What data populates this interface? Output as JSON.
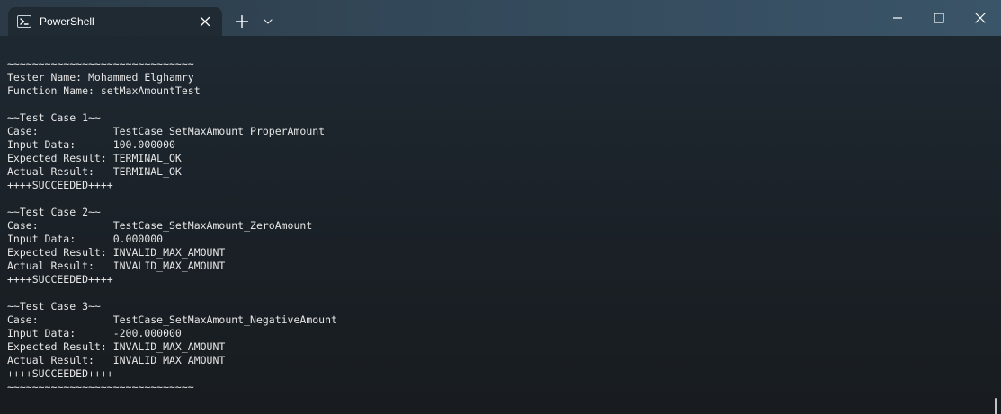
{
  "window": {
    "tab": {
      "title": "PowerShell",
      "icon": "powershell-icon"
    },
    "titlebar_icons": {
      "close_tab": "close-icon",
      "new_tab": "plus-icon",
      "dropdown": "chevron-down-icon",
      "minimize": "minimize-icon",
      "maximize": "maximize-icon",
      "close_window": "close-icon"
    }
  },
  "terminal": {
    "lines": [
      "~~~~~~~~~~~~~~~~~~~~~~~~~~~~~~",
      "Tester Name: Mohammed Elghamry",
      "Function Name: setMaxAmountTest",
      "",
      "~~Test Case 1~~",
      "Case:            TestCase_SetMaxAmount_ProperAmount",
      "Input Data:      100.000000",
      "Expected Result: TERMINAL_OK",
      "Actual Result:   TERMINAL_OK",
      "++++SUCCEEDED++++",
      "",
      "~~Test Case 2~~",
      "Case:            TestCase_SetMaxAmount_ZeroAmount",
      "Input Data:      0.000000",
      "Expected Result: INVALID_MAX_AMOUNT",
      "Actual Result:   INVALID_MAX_AMOUNT",
      "++++SUCCEEDED++++",
      "",
      "~~Test Case 3~~",
      "Case:            TestCase_SetMaxAmount_NegativeAmount",
      "Input Data:      -200.000000",
      "Expected Result: INVALID_MAX_AMOUNT",
      "Actual Result:   INVALID_MAX_AMOUNT",
      "++++SUCCEEDED++++",
      "~~~~~~~~~~~~~~~~~~~~~~~~~~~~~~"
    ]
  },
  "colors": {
    "background": "#1a2026",
    "titlebar": "#33495a",
    "tab": "#1f2a33",
    "text": "#e6e6e6"
  }
}
